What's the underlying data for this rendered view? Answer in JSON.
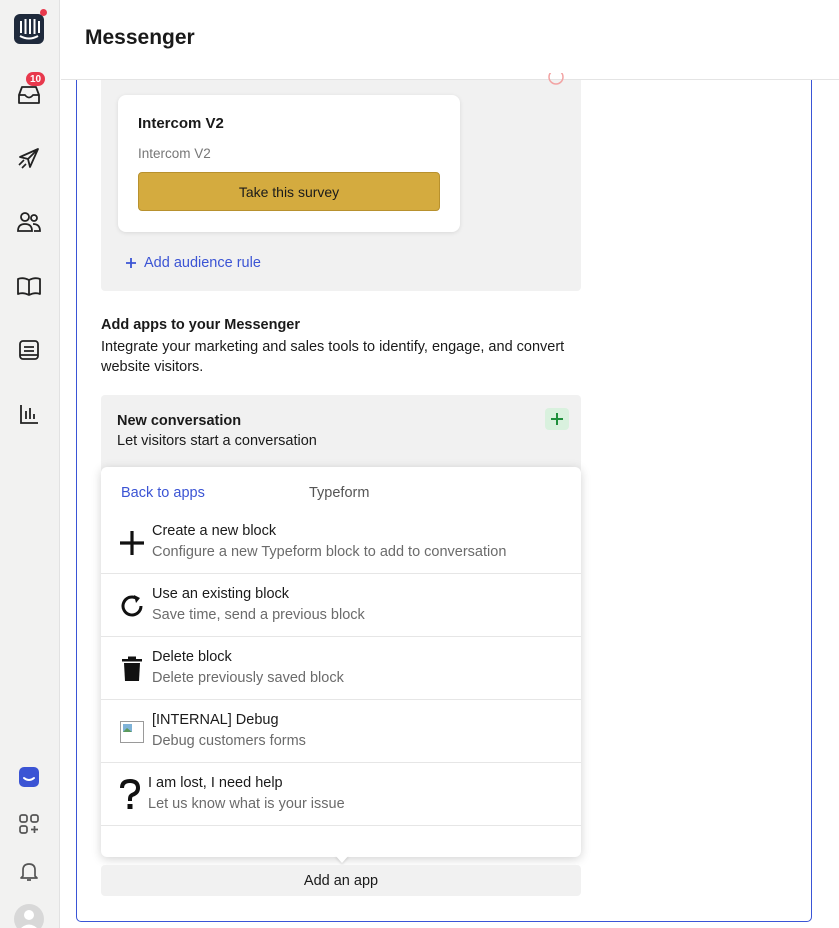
{
  "header": {
    "title": "Messenger"
  },
  "rail": {
    "inbox_badge": "10",
    "items": [
      {
        "name": "intercom-logo-icon"
      },
      {
        "name": "inbox-icon"
      },
      {
        "name": "outbound-icon"
      },
      {
        "name": "contacts-icon"
      },
      {
        "name": "articles-icon"
      },
      {
        "name": "inbox-page-icon"
      },
      {
        "name": "reports-icon"
      },
      {
        "name": "messenger-icon"
      },
      {
        "name": "apps-icon"
      },
      {
        "name": "notifications-icon"
      },
      {
        "name": "avatar"
      }
    ]
  },
  "survey": {
    "title": "Intercom V2",
    "subtitle": "Intercom V2",
    "button_label": "Take this survey"
  },
  "audience": {
    "add_rule_label": "Add audience rule"
  },
  "apps_section": {
    "title": "Add apps to your Messenger",
    "description": "Integrate your marketing and sales tools to identify, engage, and convert website visitors."
  },
  "new_conversation": {
    "title": "New conversation",
    "subtitle": "Let visitors start a conversation"
  },
  "popup": {
    "back_label": "Back to apps",
    "title": "Typeform",
    "items": [
      {
        "icon": "plus-icon",
        "name": "Create a new block",
        "subtitle": "Configure a new Typeform block to add to conversation"
      },
      {
        "icon": "refresh-icon",
        "name": "Use an existing block",
        "subtitle": "Save time, send a previous block"
      },
      {
        "icon": "trash-icon",
        "name": "Delete block",
        "subtitle": "Delete previously saved block"
      },
      {
        "icon": "broken-image-icon",
        "name": "[INTERNAL] Debug",
        "subtitle": "Debug customers forms"
      },
      {
        "icon": "question-icon",
        "name": "I am lost, I need help",
        "subtitle": "Let us know what is your issue"
      }
    ]
  },
  "add_app_label": "Add an app",
  "colors": {
    "accent": "#3b54d4",
    "survey_button": "#d4ab3f",
    "badge": "#e8394d",
    "success": "#1f8f3c"
  }
}
